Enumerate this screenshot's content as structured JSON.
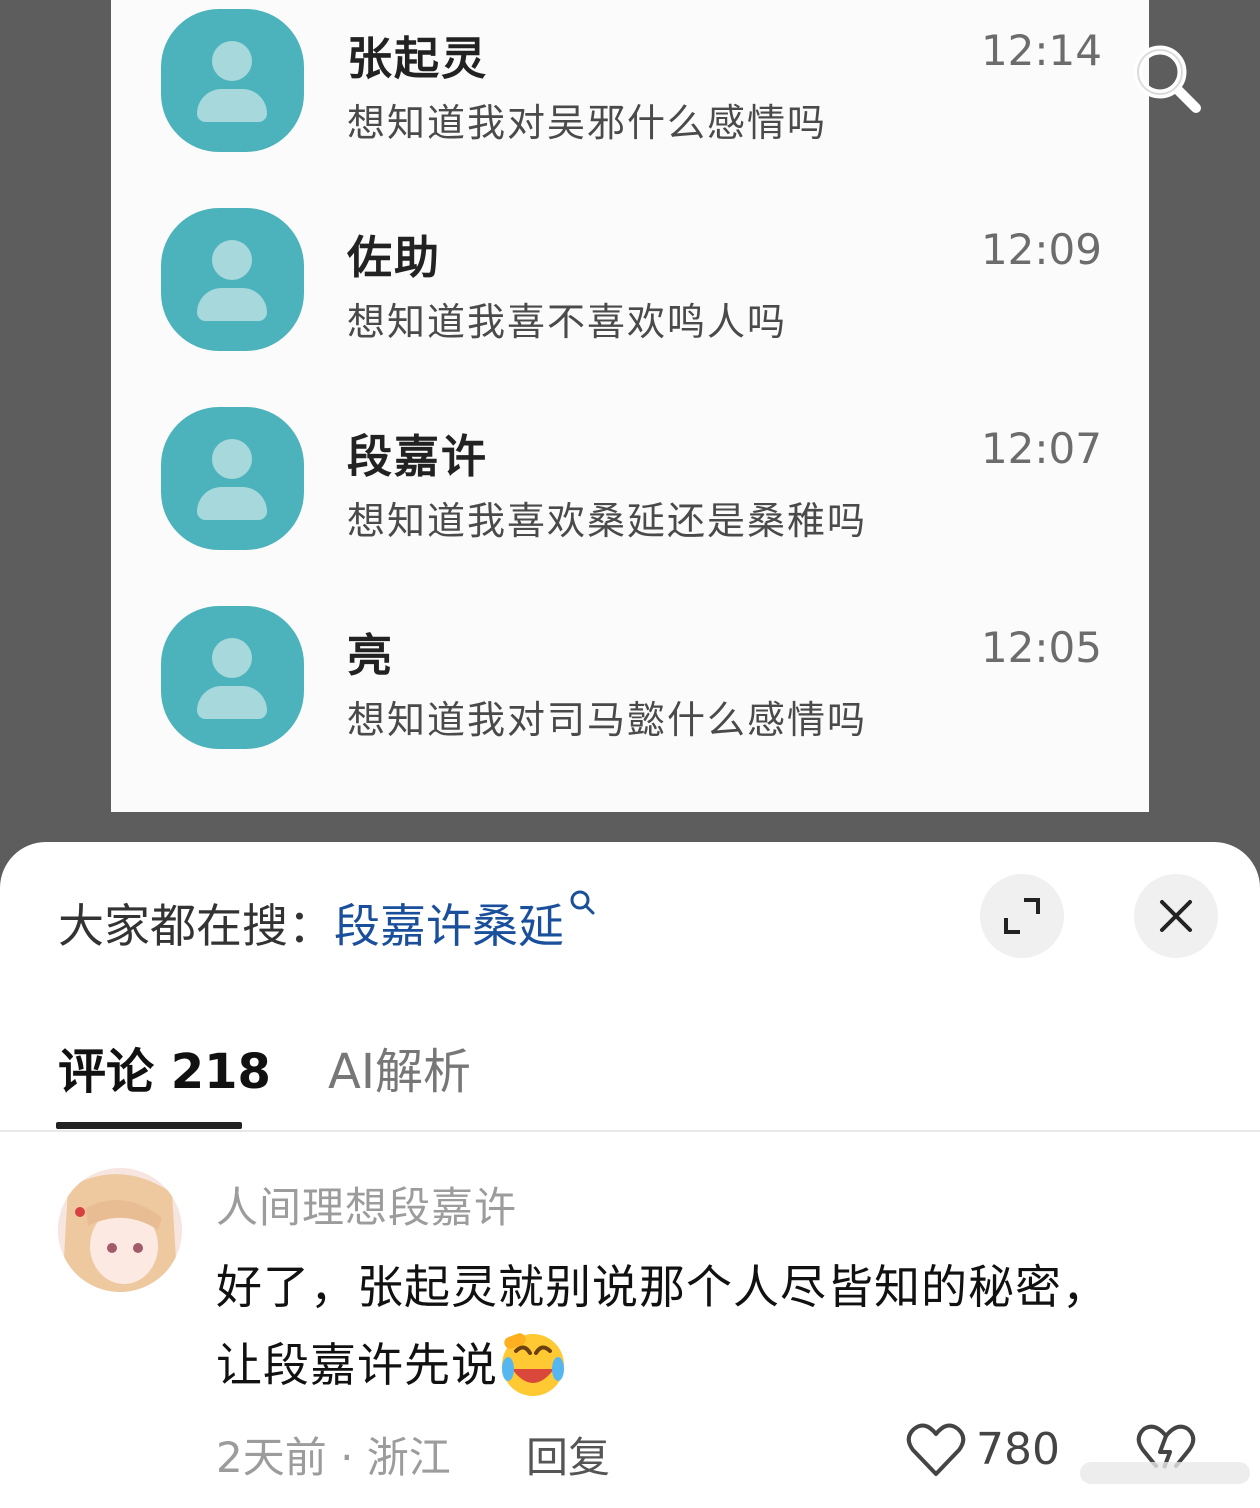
{
  "messages": [
    {
      "name": "张起灵",
      "preview": "想知道我对吴邪什么感情吗",
      "time": "12:14"
    },
    {
      "name": "佐助",
      "preview": "想知道我喜不喜欢鸣人吗",
      "time": "12:09"
    },
    {
      "name": "段嘉许",
      "preview": "想知道我喜欢桑延还是桑稚吗",
      "time": "12:07"
    },
    {
      "name": "亮",
      "preview": "想知道我对司马懿什么感情吗",
      "time": "12:05"
    }
  ],
  "hot_search": {
    "prefix": "大家都在搜：",
    "term": "段嘉许桑延"
  },
  "tabs": {
    "comments": "评论 218",
    "ai": "AI解析"
  },
  "comment": {
    "user": "人间理想段嘉许",
    "line1": "好了，张起灵就别说那个人尽皆知的秘密，",
    "line2": "让段嘉许先说",
    "meta": "2天前 · 浙江",
    "reply": "回复",
    "likes": "780"
  },
  "colors": {
    "avatar_tile": "#4cb3bc",
    "link": "#1a4f9c"
  },
  "icons": [
    "person-icon",
    "search-icon",
    "expand-icon",
    "close-icon",
    "heart-icon",
    "dislike-icon",
    "laughing-crying-emoji"
  ]
}
